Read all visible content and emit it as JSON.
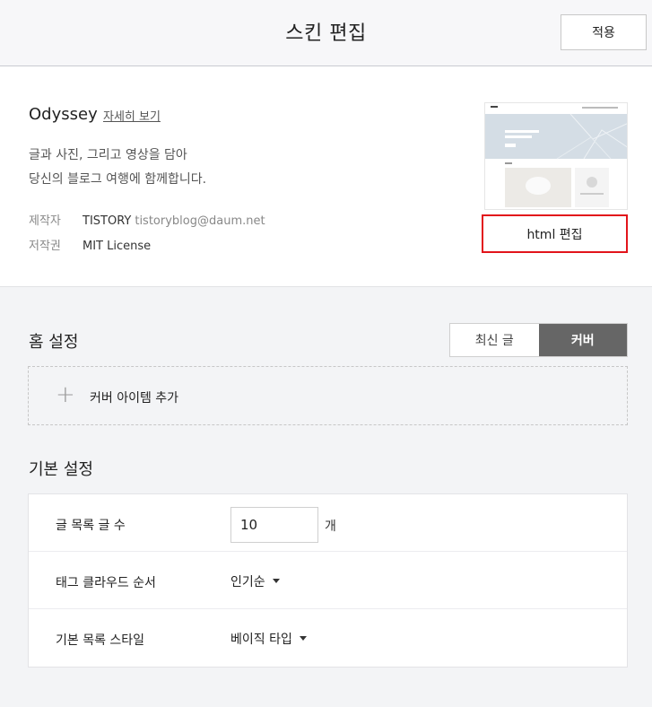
{
  "header": {
    "title": "스킨 편집",
    "apply_label": "적용"
  },
  "skin": {
    "name": "Odyssey",
    "detail_link": "자세히 보기",
    "description_line1": "글과 사진, 그리고 영상을 담아",
    "description_line2": "당신의 블로그 여행에 함께합니다.",
    "author_label": "제작자",
    "author_name": "TISTORY",
    "author_email": "tistoryblog@daum.net",
    "license_label": "저작권",
    "license_value": "MIT License",
    "html_edit_label": "html 편집"
  },
  "home_settings": {
    "title": "홈 설정",
    "toggle_recent": "최신 글",
    "toggle_cover": "커버",
    "selected": "커버",
    "add_cover_label": "커버 아이템 추가"
  },
  "basic_settings": {
    "title": "기본 설정",
    "post_count_label": "글 목록 글 수",
    "post_count_value": "10",
    "post_count_unit": "개",
    "tag_order_label": "태그 클라우드 순서",
    "tag_order_value": "인기순",
    "list_style_label": "기본 목록 스타일",
    "list_style_value": "베이직 타입"
  },
  "colors": {
    "highlight_border": "#e2141b",
    "toggle_active_bg": "#666666",
    "background": "#f3f4f6"
  }
}
